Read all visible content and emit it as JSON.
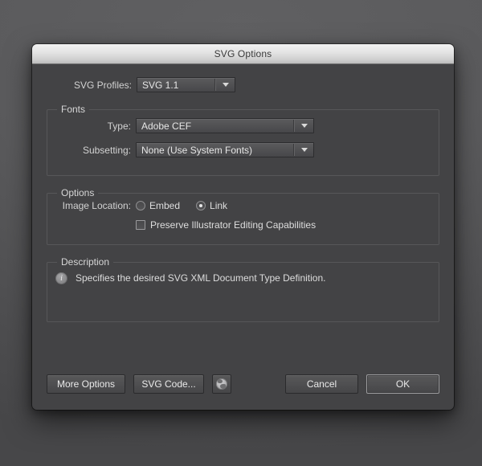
{
  "window": {
    "title": "SVG Options"
  },
  "profiles": {
    "label": "SVG Profiles:",
    "value": "SVG 1.1"
  },
  "fonts": {
    "legend": "Fonts",
    "type": {
      "label": "Type:",
      "value": "Adobe CEF"
    },
    "subsetting": {
      "label": "Subsetting:",
      "value": "None (Use System Fonts)"
    }
  },
  "options": {
    "legend": "Options",
    "image_location": {
      "label": "Image Location:",
      "embed_label": "Embed",
      "link_label": "Link",
      "selected": "Link"
    },
    "preserve": {
      "label": "Preserve Illustrator Editing Capabilities",
      "checked": false
    }
  },
  "description": {
    "legend": "Description",
    "icon": "info-icon",
    "text": "Specifies the desired SVG XML Document Type Definition."
  },
  "buttons": {
    "more_options": "More Options",
    "svg_code": "SVG Code...",
    "globe_icon": "globe-icon",
    "cancel": "Cancel",
    "ok": "OK"
  },
  "colors": {
    "dialog_bg": "#434345",
    "titlebar_top": "#f2f2f2",
    "text": "#dedede",
    "group_border": "#575759"
  }
}
